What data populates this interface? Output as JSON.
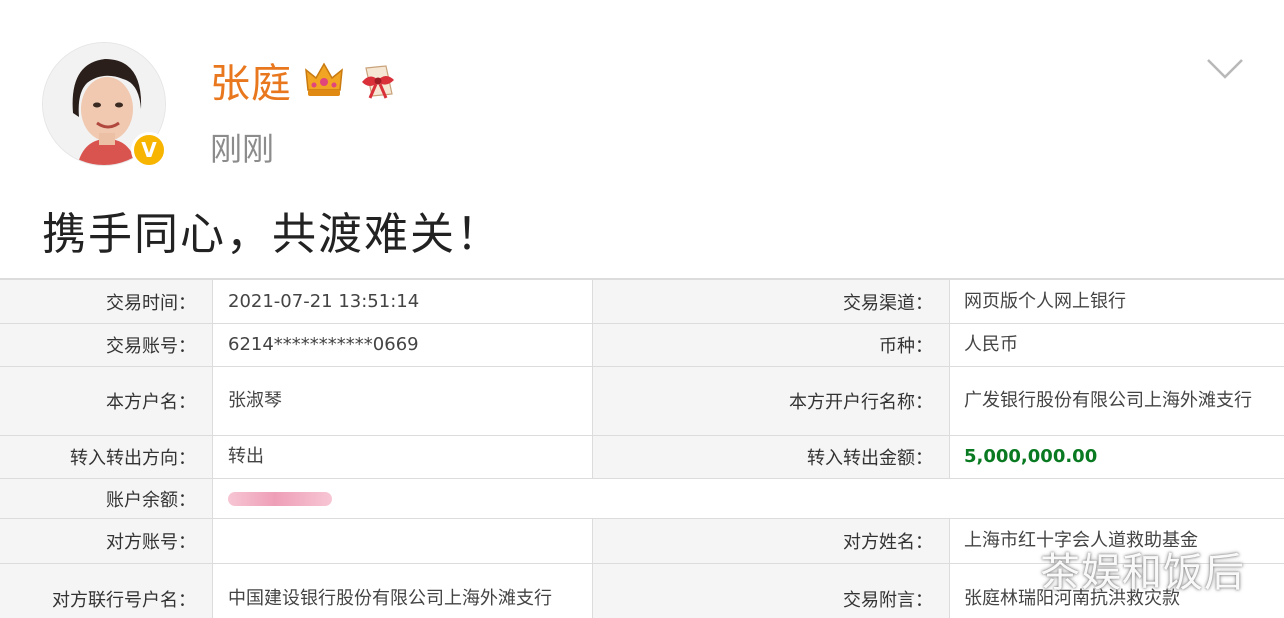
{
  "post": {
    "username": "张庭",
    "timestamp": "刚刚",
    "text": "携手同心，共渡难关！"
  },
  "receipt": {
    "rows": [
      {
        "label1": "交易时间：",
        "value1": "2021-07-21 13:51:14",
        "label2": "交易渠道：",
        "value2": "网页版个人网上银行"
      },
      {
        "label1": "交易账号：",
        "value1": "6214***********0669",
        "label2": "币种：",
        "value2": "人民币"
      },
      {
        "label1": "本方户名：",
        "value1": "张淑琴",
        "label2": "本方开户行名称：",
        "value2": "广发银行股份有限公司上海外滩支行"
      },
      {
        "label1": "转入转出方向：",
        "value1": "转出",
        "label2": "转入转出金额：",
        "value2": "5,000,000.00"
      },
      {
        "label1": "账户余额：",
        "value1": "",
        "label2": "",
        "value2": ""
      },
      {
        "label1": "对方账号：",
        "value1": "",
        "label2": "对方姓名：",
        "value2": "上海市红十字会人道救助基金"
      },
      {
        "label1": "对方联行号户名：",
        "value1": "中国建设银行股份有限公司上海外滩支行",
        "label2": "交易附言：",
        "value2": "张庭林瑞阳河南抗洪救灾款"
      }
    ]
  },
  "watermark": "茶娱和饭后",
  "colors": {
    "username": "#e8771e",
    "amount": "#0a7a22",
    "verified": "#f7b500"
  },
  "icons": [
    "avatar-photo",
    "verified-badge-icon",
    "crown-badge-icon",
    "gift-badge-icon",
    "chevron-down-icon"
  ]
}
